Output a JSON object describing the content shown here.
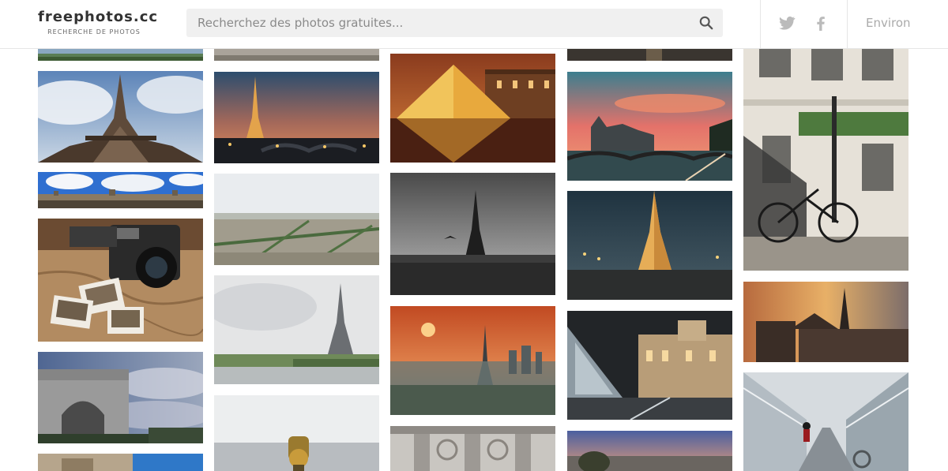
{
  "header": {
    "logo_title": "freephotos.cc",
    "logo_subtitle": "RECHERCHE DE PHOTOS",
    "search_placeholder": "Recherchez des photos gratuites...",
    "nav_about": "Environ"
  },
  "icons": {
    "search": "search-icon",
    "twitter": "twitter-icon",
    "facebook": "facebook-icon"
  },
  "colors": {
    "search_bg": "#f0f0f0",
    "icon_gray": "#bbbbbb",
    "text_dark": "#333333"
  },
  "gallery": {
    "columns": [
      [
        "Tour Eiffel vue d'en bas",
        "Panorama du Louvre",
        "Appareil photo vintage et carte",
        "Arc de Triomphe",
        "Bâtiment orné"
      ],
      [
        "Tour Eiffel au crépuscule",
        "Vue aérienne de Paris",
        "Tour Eiffel et la Seine",
        "Longue-vue sur Paris"
      ],
      [
        "Pyramide du Louvre la nuit",
        "Tour Eiffel en noir et blanc",
        "Coucher de soleil sur Paris",
        "Façade classique"
      ],
      [
        "Conciergerie au coucher du soleil",
        "Tour Eiffel illuminée",
        "Louvre la nuit",
        "Gargouille de Notre-Dame"
      ],
      [
        "Vélo devant immeuble parisien",
        "Notre-Dame au coucher du soleil",
        "Escalier de métro moderne"
      ]
    ]
  }
}
